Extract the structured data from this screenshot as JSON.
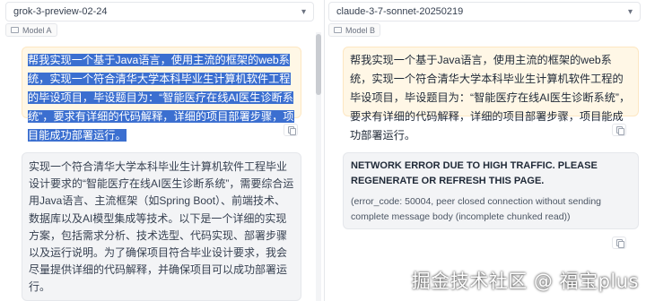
{
  "left": {
    "model_name": "grok-3-preview-02-24",
    "model_tag": "Model A",
    "user_message": "帮我实现一个基于Java语言，使用主流的框架的web系统，实现一个符合清华大学本科毕业生计算机软件工程的毕设项目，毕设题目为：“智能医疗在线AI医生诊断系统”，要求有详细的代码解释，详细的项目部署步骤，项目能成功部署运行。",
    "bot_message": "实现一个符合清华大学本科毕业生计算机软件工程毕业设计要求的“智能医疗在线AI医生诊断系统”，需要综合运用Java语言、主流框架（如Spring Boot）、前端技术、数据库以及AI模型集成等技术。以下是一个详细的实现方案，包括需求分析、技术选型、代码实现、部署步骤以及运行说明。为了确保项目符合毕业设计要求，我会尽量提供详细的代码解释，并确保项目可以成功部署运行。"
  },
  "right": {
    "model_name": "claude-3-7-sonnet-20250219",
    "model_tag": "Model B",
    "user_message": "帮我实现一个基于Java语言，使用主流的框架的web系统，实现一个符合清华大学本科毕业生计算机软件工程的毕设项目，毕设题目为：“智能医疗在线AI医生诊断系统”，要求有详细的代码解释，详细的项目部署步骤，项目能成功部署运行。",
    "error_title": "NETWORK ERROR DUE TO HIGH TRAFFIC. PLEASE REGENERATE OR REFRESH THIS PAGE.",
    "error_detail": "(error_code: 50004, peer closed connection without sending complete message body (incomplete chunked read))"
  },
  "watermark": "掘金技术社区 @ 福宝plus",
  "colors": {
    "user_bubble": "#fff7e6",
    "bot_bubble": "#f3f4f6",
    "selection": "#3b6fd0"
  }
}
